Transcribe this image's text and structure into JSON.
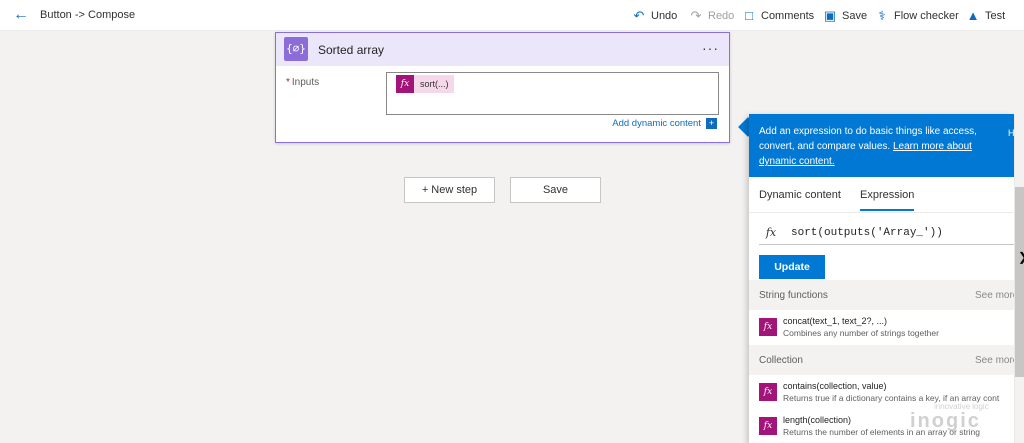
{
  "topbar": {
    "breadcrumb": "Button -> Compose",
    "commands": {
      "undo": "Undo",
      "redo": "Redo",
      "comments": "Comments",
      "save": "Save",
      "flow_checker": "Flow checker",
      "test": "Test"
    }
  },
  "card": {
    "title": "Sorted array",
    "icon_glyph": "{∅}",
    "inputs_label": "Inputs",
    "required_mark": "*",
    "token_label": "sort(...)",
    "add_dynamic_content": "Add dynamic content",
    "more_glyph": "···"
  },
  "buttons": {
    "new_step": "+ New step",
    "save": "Save"
  },
  "panel": {
    "info_text": "Add an expression to do basic things like access, convert, and compare values.",
    "info_link": "Learn more about dynamic content.",
    "edge_text": "H",
    "tabs": [
      "Dynamic content",
      "Expression"
    ],
    "active_tab": "Expression",
    "expression_value": "sort(outputs('Array_'))",
    "update_label": "Update",
    "sections": [
      {
        "name": "String functions",
        "see_more": "See more",
        "functions": [
          {
            "signature": "concat(text_1, text_2?, ...)",
            "description": "Combines any number of strings together"
          }
        ]
      },
      {
        "name": "Collection",
        "see_more": "See more",
        "functions": [
          {
            "signature": "contains(collection, value)",
            "description": "Returns true if a dictionary contains a key, if an array cont"
          },
          {
            "signature": "length(collection)",
            "description": "Returns the number of elements in an array or string"
          }
        ]
      }
    ]
  },
  "watermark": {
    "tagline": "innovative logic",
    "logo": "inogic"
  },
  "colors": {
    "accent": "#0078d4",
    "card_header": "#ece6fb",
    "card_icon": "#8c6cd9",
    "fx_badge": "#a3147a"
  }
}
